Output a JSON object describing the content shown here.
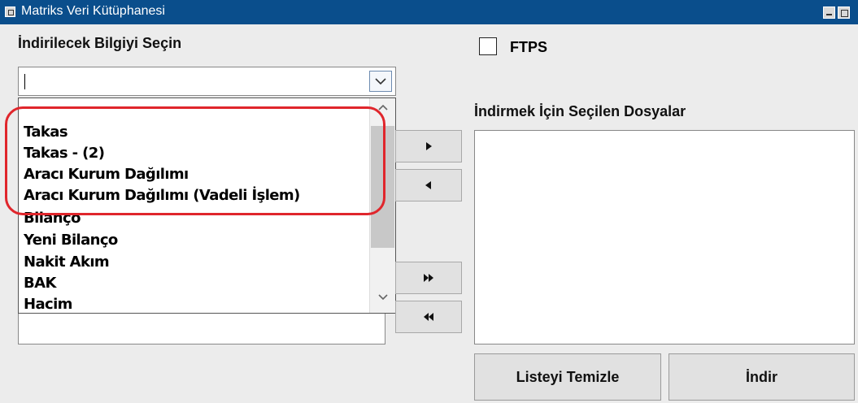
{
  "window": {
    "title": "Matriks Veri Kütüphanesi",
    "system_icon": "system-menu-icon",
    "controls": [
      "minimize-icon",
      "restore-icon"
    ]
  },
  "left_panel": {
    "label": "İndirilecek Bilgiyi Seçin",
    "combo_value": "",
    "dropdown_items": [
      "Takas",
      "Takas - (2)",
      "Aracı Kurum Dağılımı",
      "Aracı Kurum Dağılımı (Vadeli İşlem)",
      "Bilanço",
      "Yeni Bilanço",
      "Nakit Akım",
      "BAK",
      "Hacim"
    ]
  },
  "ftps": {
    "label": "FTPS",
    "checked": false
  },
  "transfer_buttons": {
    "add_icon": "arrow-right-icon",
    "remove_icon": "arrow-left-icon",
    "add_all_icon": "double-arrow-right-icon",
    "remove_all_icon": "double-arrow-left-icon"
  },
  "right_panel": {
    "label": "İndirmek İçin Seçilen Dosyalar",
    "selected_files": []
  },
  "actions": {
    "clear_label": "Listeyi Temizle",
    "download_label": "İndir"
  },
  "colors": {
    "titlebar": "#0a4e8c",
    "highlight": "#e0262c",
    "window_bg": "#ececec"
  }
}
